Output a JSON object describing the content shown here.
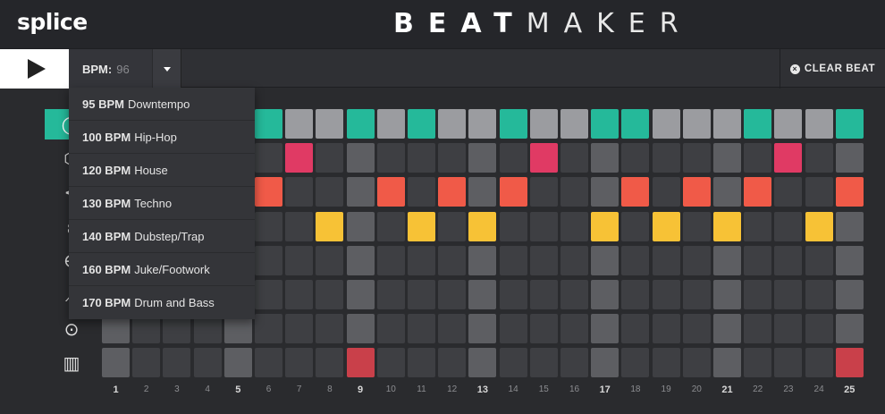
{
  "header": {
    "logo": "splice",
    "title_bold": "BEAT",
    "title_light": "MAKER"
  },
  "toolbar": {
    "play_icon": "play-icon",
    "bpm_label": "BPM:",
    "bpm_value": "96",
    "caret_icon": "chevron-down-icon",
    "clear_icon": "close-circle-icon",
    "clear_label": "CLEAR BEAT"
  },
  "bpm_menu": {
    "items": [
      {
        "bpm": "95 BPM",
        "genre": "Downtempo"
      },
      {
        "bpm": "100 BPM",
        "genre": "Hip-Hop"
      },
      {
        "bpm": "120 BPM",
        "genre": "House"
      },
      {
        "bpm": "130 BPM",
        "genre": "Techno"
      },
      {
        "bpm": "140 BPM",
        "genre": "Dubstep/Trap"
      },
      {
        "bpm": "160 BPM",
        "genre": "Juke/Footwork"
      },
      {
        "bpm": "170 BPM",
        "genre": "Drum and Bass"
      }
    ]
  },
  "instruments": [
    {
      "icon": "open-hihat-icon",
      "glyph": "◯",
      "active": true
    },
    {
      "icon": "closed-hihat-icon",
      "glyph": "⬡",
      "active": false
    },
    {
      "icon": "clap-icon",
      "glyph": "<",
      "active": false
    },
    {
      "icon": "snare-icon",
      "glyph": "ε",
      "active": false
    },
    {
      "icon": "kick-icon",
      "glyph": "∈",
      "active": false
    },
    {
      "icon": "perc-icon",
      "glyph": "⟋",
      "active": false
    },
    {
      "icon": "shaker-icon",
      "glyph": "⊙",
      "active": false
    },
    {
      "icon": "keys-icon",
      "glyph": "▥",
      "active": false
    }
  ],
  "colors": {
    "teal": "#25b99a",
    "pink": "#e03a64",
    "orange": "#f05a48",
    "yellow": "#f7c236",
    "red": "#c9404a",
    "off_light": "#9b9ca0",
    "off_dark": "#3e3f43",
    "off_accent": "#5d5e62"
  },
  "steps": [
    "1",
    "2",
    "3",
    "4",
    "5",
    "6",
    "7",
    "8",
    "9",
    "10",
    "11",
    "12",
    "13",
    "14",
    "15",
    "16",
    "17",
    "18",
    "19",
    "20",
    "21",
    "22",
    "23",
    "24",
    "25"
  ],
  "pattern": [
    [
      "o",
      "o",
      "o",
      "o",
      "o",
      "t",
      "l",
      "l",
      "t",
      "l",
      "t",
      "l",
      "l",
      "t",
      "l",
      "l",
      "t",
      "t",
      "l",
      "l",
      "l",
      "t",
      "l",
      "l",
      "t"
    ],
    [
      "o",
      "o",
      "o",
      "o",
      "o",
      "o",
      "p",
      "o",
      "o",
      "o",
      "o",
      "o",
      "o",
      "o",
      "p",
      "o",
      "o",
      "o",
      "o",
      "o",
      "o",
      "o",
      "p",
      "o",
      "o"
    ],
    [
      "o",
      "o",
      "o",
      "o",
      "o",
      "r",
      "o",
      "o",
      "o",
      "r",
      "o",
      "r",
      "o",
      "r",
      "o",
      "o",
      "o",
      "r",
      "o",
      "r",
      "o",
      "r",
      "o",
      "o",
      "r"
    ],
    [
      "o",
      "o",
      "o",
      "o",
      "o",
      "o",
      "o",
      "y",
      "o",
      "o",
      "y",
      "o",
      "y",
      "o",
      "o",
      "o",
      "y",
      "o",
      "y",
      "o",
      "y",
      "o",
      "o",
      "y",
      "o"
    ],
    [
      "o",
      "o",
      "o",
      "o",
      "o",
      "o",
      "o",
      "o",
      "o",
      "o",
      "o",
      "o",
      "o",
      "o",
      "o",
      "o",
      "o",
      "o",
      "o",
      "o",
      "o",
      "o",
      "o",
      "o",
      "o"
    ],
    [
      "o",
      "o",
      "o",
      "o",
      "o",
      "o",
      "o",
      "o",
      "o",
      "o",
      "o",
      "o",
      "o",
      "o",
      "o",
      "o",
      "o",
      "o",
      "o",
      "o",
      "o",
      "o",
      "o",
      "o",
      "o"
    ],
    [
      "o",
      "o",
      "o",
      "o",
      "o",
      "o",
      "o",
      "o",
      "o",
      "o",
      "o",
      "o",
      "o",
      "o",
      "o",
      "o",
      "o",
      "o",
      "o",
      "o",
      "o",
      "o",
      "o",
      "o",
      "o"
    ],
    [
      "o",
      "o",
      "o",
      "o",
      "o",
      "o",
      "o",
      "o",
      "d",
      "o",
      "o",
      "o",
      "o",
      "o",
      "o",
      "o",
      "o",
      "o",
      "o",
      "o",
      "o",
      "o",
      "o",
      "o",
      "d"
    ]
  ]
}
